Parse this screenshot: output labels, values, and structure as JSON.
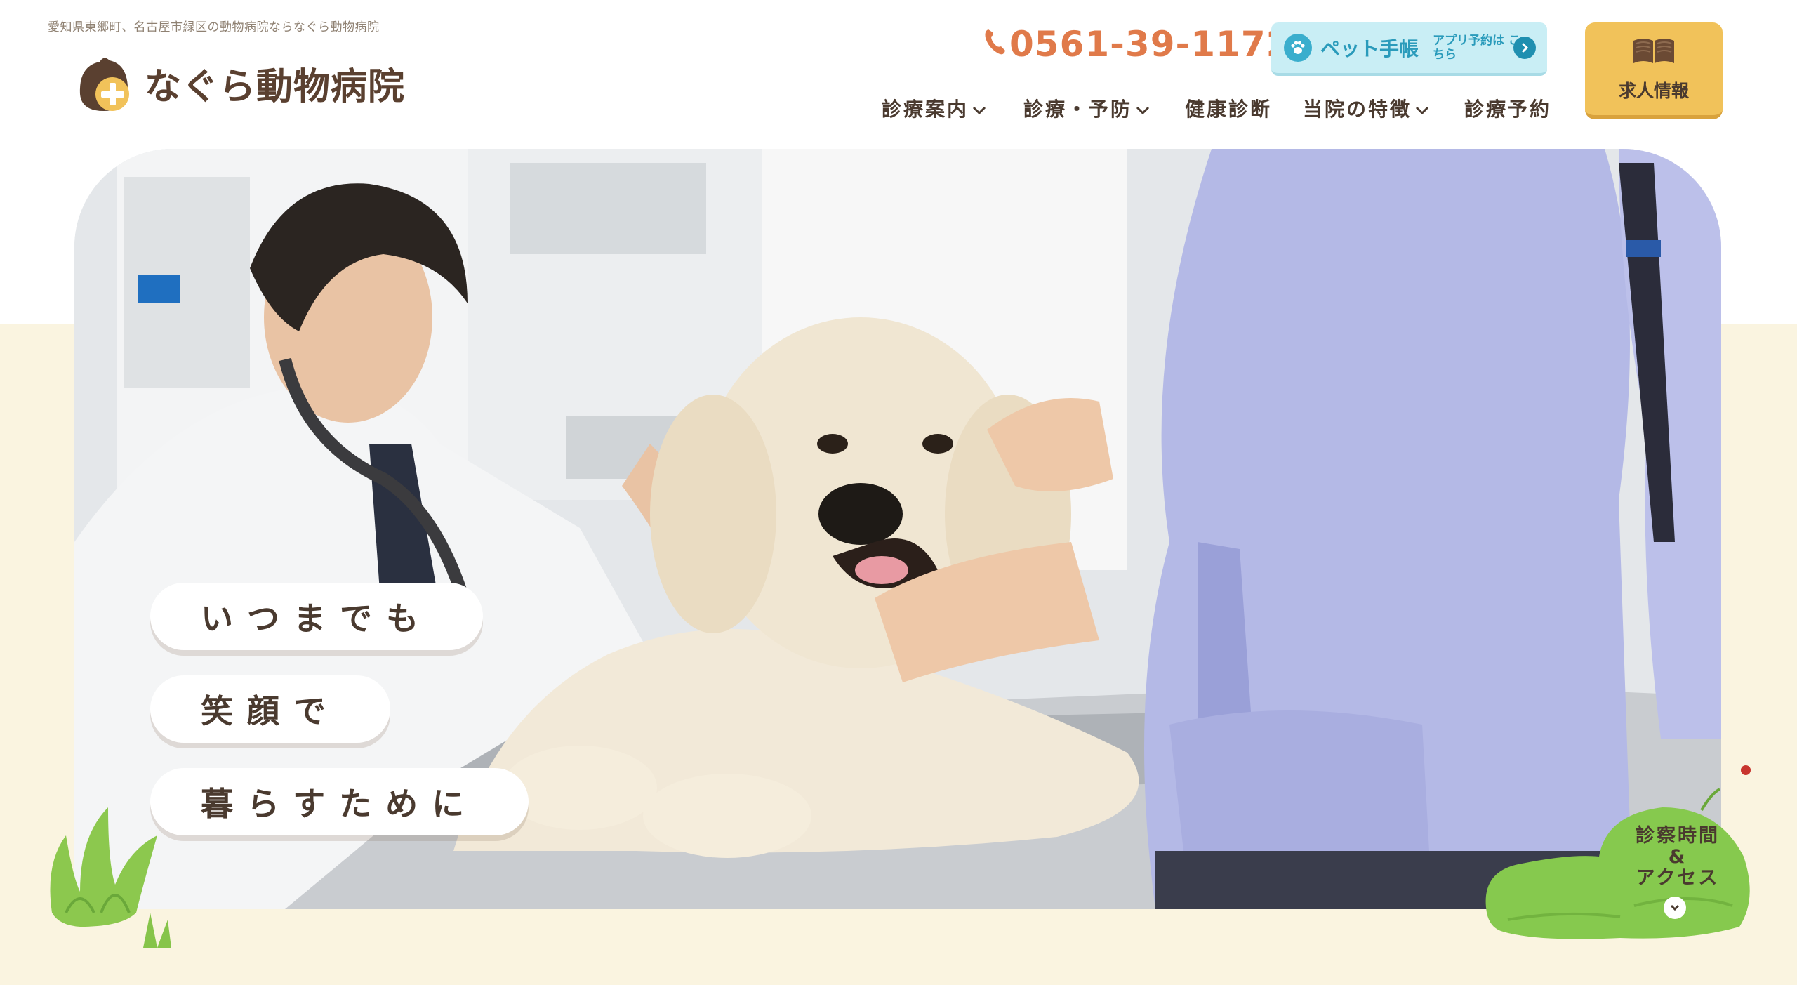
{
  "header": {
    "tagline": "愛知県東郷町、名古屋市緑区の動物病院ならなぐら動物病院",
    "logo_text": "なぐら動物病院",
    "phone": "0561-39-1172",
    "app_button": {
      "label": "ペット手帳",
      "sub": "アプリ予約は こちら"
    },
    "recruit_button": {
      "label": "求人情報"
    }
  },
  "nav": {
    "items": [
      {
        "label": "診療案内",
        "has_dropdown": true
      },
      {
        "label": "診療・予防",
        "has_dropdown": true
      },
      {
        "label": "健康診断",
        "has_dropdown": false
      },
      {
        "label": "当院の特徴",
        "has_dropdown": true
      },
      {
        "label": "診療予約",
        "has_dropdown": false
      }
    ]
  },
  "hero": {
    "catch": [
      "いつまでも",
      "笑顔で",
      "暮らすために"
    ]
  },
  "access_badge": {
    "line1": "診察時間",
    "line2": "&",
    "line3": "アクセス"
  },
  "colors": {
    "brand_brown": "#5a4030",
    "accent_orange": "#e07a4a",
    "app_blue": "#c9eef5",
    "recruit_gold": "#f1c25a",
    "cream_bg": "#faf4e0",
    "grass_green": "#7cc44a"
  },
  "icons": [
    "phone-icon",
    "paw-icon",
    "arrow-right-icon",
    "book-icon",
    "chevron-down-icon"
  ]
}
